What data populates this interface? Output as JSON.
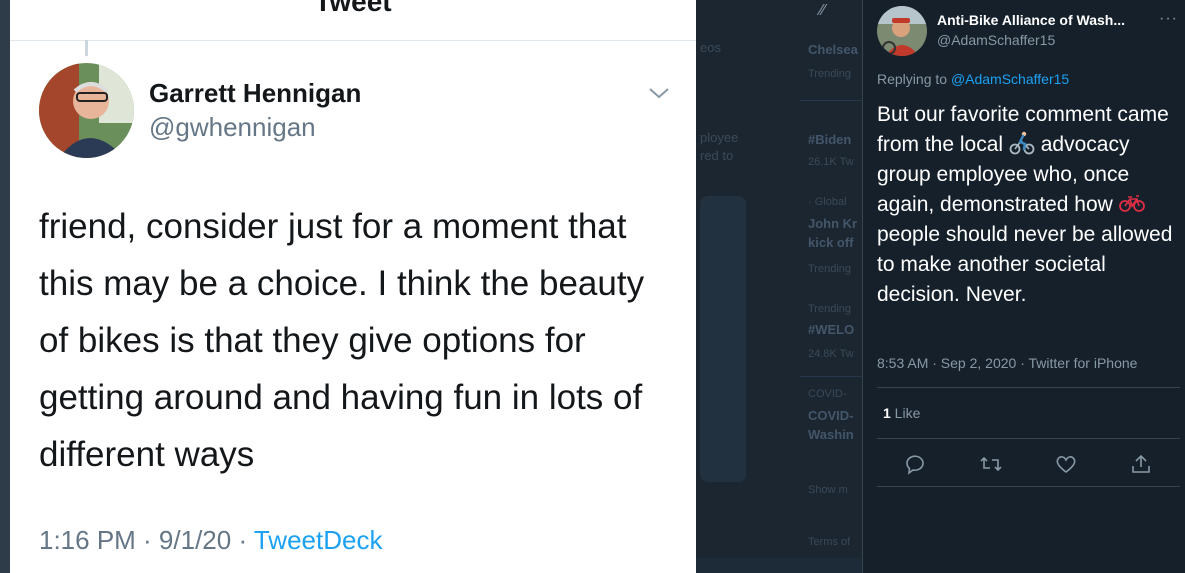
{
  "left_tweet": {
    "header_title": "Tweet",
    "author_name": "Garrett Hennigan",
    "author_handle": "@gwhennigan",
    "body": "friend, consider just for a moment that this may be a choice. I think the beauty of bikes is that they give options for getting around and having fun in lots of different ways",
    "time_date": "1:16 PM · 9/1/20 · ",
    "source": "TweetDeck"
  },
  "background": {
    "ghost_texts": [
      "Chelsea",
      "Trending",
      "#Biden",
      "26.1K Tw",
      "· Global",
      "John Kr",
      "kick off",
      "Trending",
      "Trending",
      "#WELO",
      "24.8K Tw",
      "COVID-",
      "COVID-",
      "Washin",
      "Show m",
      "Terms of",
      "eos",
      "ployee",
      "red to"
    ]
  },
  "right_tweet": {
    "account_name": "Anti-Bike Alliance of Wash...",
    "account_handle": "@AdamSchaffer15",
    "replying_prefix": "Replying to ",
    "replying_handle": "@AdamSchaffer15",
    "body_parts": {
      "p1": "But our favorite comment came from the local ",
      "p2": " advocacy group employee who, once again, demonstrated how ",
      "p3": " people should never be allowed to make another societal decision. Never."
    },
    "emoji_1": "person-biking-icon",
    "emoji_2": "bicycle-icon",
    "meta": "8:53 AM · Sep 2, 2020 · Twitter for iPhone",
    "like_count": "1",
    "like_label": " Like"
  },
  "colors": {
    "dark_bg": "#15202b",
    "accent": "#1da1f2",
    "muted": "#8899a6",
    "light_muted": "#657786"
  }
}
